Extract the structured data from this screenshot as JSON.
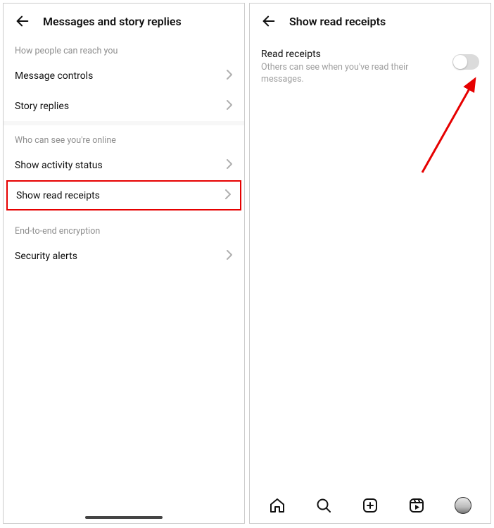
{
  "left": {
    "title": "Messages and story replies",
    "section1": {
      "label": "How people can reach you",
      "items": [
        {
          "label": "Message controls"
        },
        {
          "label": "Story replies"
        }
      ]
    },
    "section2": {
      "label": "Who can see you're online",
      "items": [
        {
          "label": "Show activity status"
        },
        {
          "label": "Show read receipts"
        }
      ]
    },
    "section3": {
      "label": "End-to-end encryption",
      "items": [
        {
          "label": "Security alerts"
        }
      ]
    }
  },
  "right": {
    "title": "Show read receipts",
    "setting": {
      "title": "Read receipts",
      "description": "Others can see when you've read their messages.",
      "enabled": false
    }
  },
  "annotation": {
    "highlighted_row": "Show read receipts",
    "arrow_target": "toggle"
  }
}
